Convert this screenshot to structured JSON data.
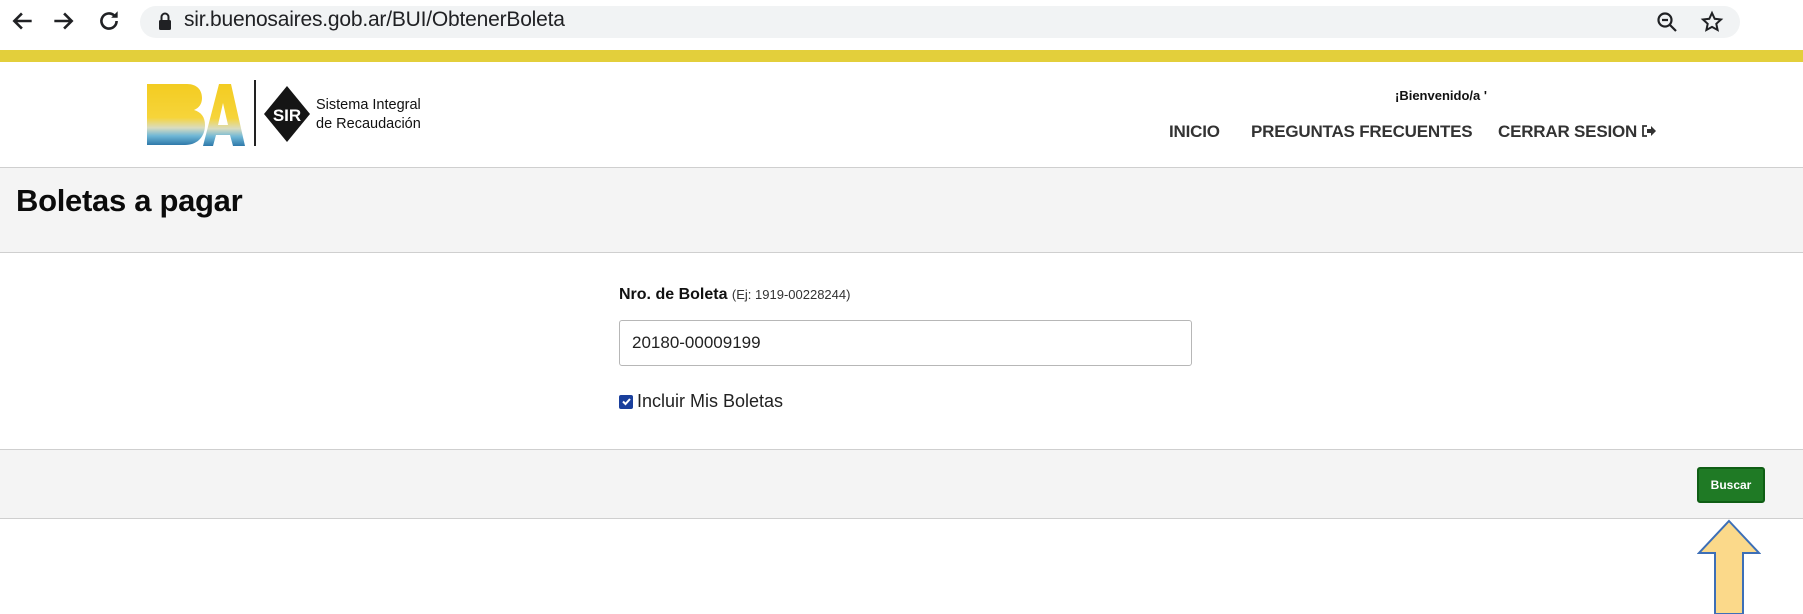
{
  "browser": {
    "url": "sir.buenosaires.gob.ar/BUI/ObtenerBoleta"
  },
  "header": {
    "system_name_line1": "Sistema Integral",
    "system_name_line2": "de Recaudación",
    "welcome": "¡Bienvenido/a '",
    "nav": {
      "inicio": "INICIO",
      "faq": "PREGUNTAS FRECUENTES",
      "logout": "CERRAR SESION"
    }
  },
  "page": {
    "title": "Boletas a pagar"
  },
  "form": {
    "label": "Nro. de Boleta",
    "hint": "(Ej: 1919-00228244)",
    "value": "20180-00009199",
    "checkbox_label": "Incluir Mis Boletas",
    "checkbox_checked": true,
    "submit_label": "Buscar"
  },
  "colors": {
    "yellow": "#e3cf3b",
    "button_green": "#1f7a25",
    "checkbox_blue": "#1a3f9c"
  }
}
